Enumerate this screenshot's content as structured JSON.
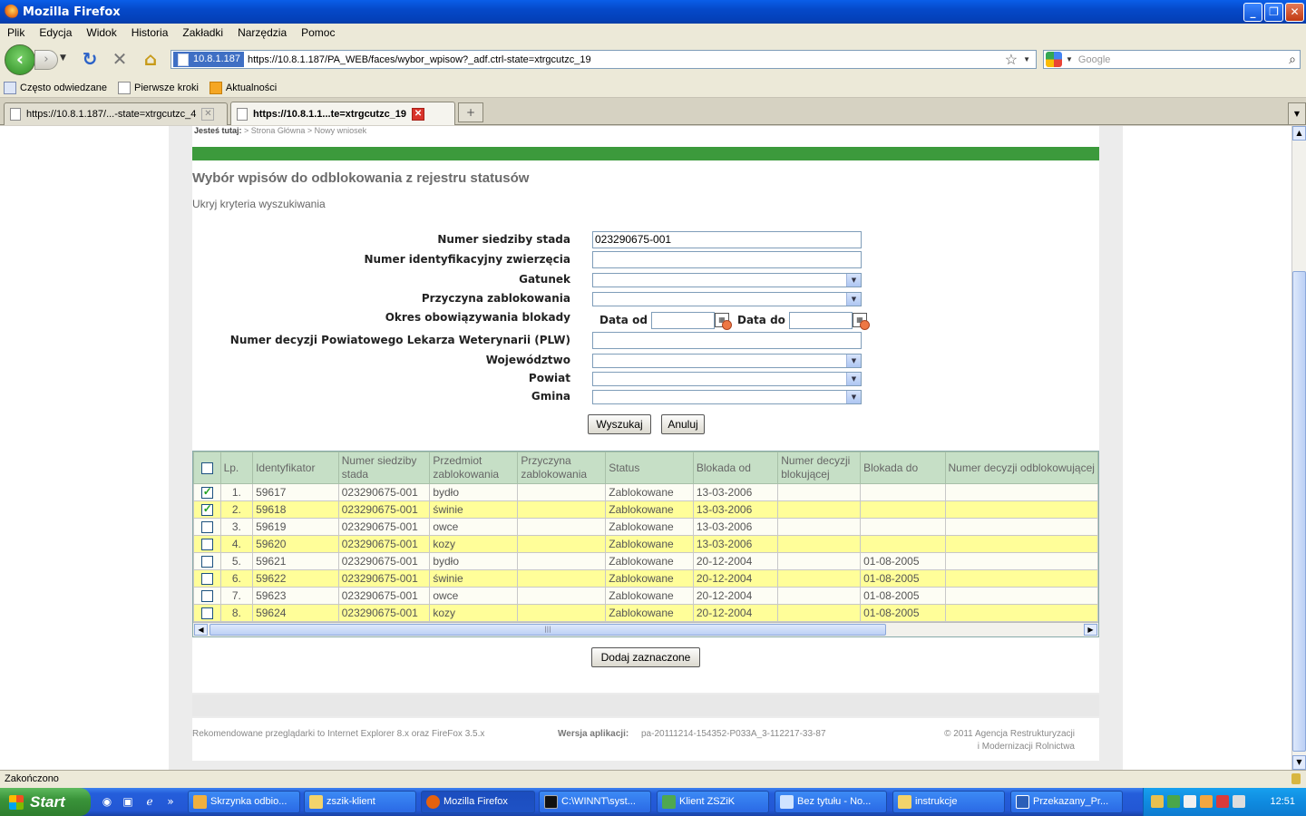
{
  "window": {
    "title": "Mozilla Firefox",
    "min": "_",
    "max": "❐",
    "close": "✕"
  },
  "menu": [
    "Plik",
    "Edycja",
    "Widok",
    "Historia",
    "Zakładki",
    "Narzędzia",
    "Pomoc"
  ],
  "nav": {
    "identity": "10.8.1.187",
    "url": "https://10.8.1.187/PA_WEB/faces/wybor_wpisow?_adf.ctrl-state=xtrgcutzc_19",
    "search_placeholder": "Google"
  },
  "bookmarks": [
    "Często odwiedzane",
    "Pierwsze kroki",
    "Aktualności"
  ],
  "tabs": [
    {
      "label": "https://10.8.1.187/...-state=xtrgcutzc_4"
    },
    {
      "label": "https://10.8.1.1...te=xtrgcutzc_19"
    }
  ],
  "page": {
    "breadcrumb_prefix": "Jesteś tutaj:",
    "breadcrumb": "> Strona Główna > Nowy wniosek",
    "title": "Wybór wpisów do odblokowania z rejestru statusów",
    "hide_criteria": "Ukryj kryteria wyszukiwania",
    "form": {
      "herd_label": "Numer siedziby stada",
      "herd_value": "023290675-001",
      "animal_label": "Numer identyfikacyjny zwierzęcia",
      "species_label": "Gatunek",
      "reason_label": "Przyczyna zablokowania",
      "period_label": "Okres obowiązywania blokady",
      "date_from_label": "Data od",
      "date_to_label": "Data do",
      "decision_label": "Numer decyzji Powiatowego Lekarza Weterynarii (PLW)",
      "voivodeship_label": "Województwo",
      "county_label": "Powiat",
      "commune_label": "Gmina"
    },
    "search_button": "Wyszukaj",
    "cancel_button": "Anuluj",
    "add_button": "Dodaj zaznaczone"
  },
  "table": {
    "headers": [
      "Lp.",
      "Identyfikator",
      "Numer siedziby stada",
      "Przedmiot zablokowania",
      "Przyczyna zablokowania",
      "Status",
      "Blokada od",
      "Numer decyzji blokującej",
      "Blokada do",
      "Numer decyzji odblokowującej"
    ],
    "rows": [
      {
        "checked": true,
        "lp": "1.",
        "id": "59617",
        "herd": "023290675-001",
        "subject": "bydło",
        "reason": "",
        "status": "Zablokowane",
        "from": "13-03-2006",
        "decision": "",
        "to": ""
      },
      {
        "checked": true,
        "lp": "2.",
        "id": "59618",
        "herd": "023290675-001",
        "subject": "świnie",
        "reason": "",
        "status": "Zablokowane",
        "from": "13-03-2006",
        "decision": "",
        "to": ""
      },
      {
        "checked": false,
        "lp": "3.",
        "id": "59619",
        "herd": "023290675-001",
        "subject": "owce",
        "reason": "",
        "status": "Zablokowane",
        "from": "13-03-2006",
        "decision": "",
        "to": ""
      },
      {
        "checked": false,
        "lp": "4.",
        "id": "59620",
        "herd": "023290675-001",
        "subject": "kozy",
        "reason": "",
        "status": "Zablokowane",
        "from": "13-03-2006",
        "decision": "",
        "to": ""
      },
      {
        "checked": false,
        "lp": "5.",
        "id": "59621",
        "herd": "023290675-001",
        "subject": "bydło",
        "reason": "",
        "status": "Zablokowane",
        "from": "20-12-2004",
        "decision": "",
        "to": "01-08-2005"
      },
      {
        "checked": false,
        "lp": "6.",
        "id": "59622",
        "herd": "023290675-001",
        "subject": "świnie",
        "reason": "",
        "status": "Zablokowane",
        "from": "20-12-2004",
        "decision": "",
        "to": "01-08-2005"
      },
      {
        "checked": false,
        "lp": "7.",
        "id": "59623",
        "herd": "023290675-001",
        "subject": "owce",
        "reason": "",
        "status": "Zablokowane",
        "from": "20-12-2004",
        "decision": "",
        "to": "01-08-2005"
      },
      {
        "checked": false,
        "lp": "8.",
        "id": "59624",
        "herd": "023290675-001",
        "subject": "kozy",
        "reason": "",
        "status": "Zablokowane",
        "from": "20-12-2004",
        "decision": "",
        "to": "01-08-2005"
      }
    ]
  },
  "footer": {
    "browsers": "Rekomendowane przeglądarki to Internet Explorer 8.x oraz FireFox 3.5.x",
    "version_label": "Wersja aplikacji:",
    "version": "pa-20111214-154352-P033A_3-112217-33-87",
    "copyright_1": "© 2011 Agencja Restrukturyzacji",
    "copyright_2": "i Modernizacji Rolnictwa"
  },
  "status": "Zakończono",
  "taskbar": {
    "start": "Start",
    "tasks": [
      "Skrzynka odbio...",
      "zszik-klient",
      "Mozilla Firefox",
      "C:\\WINNT\\syst...",
      "Klient ZSZiK",
      "Bez tytułu - No...",
      "instrukcje",
      "Przekazany_Pr..."
    ],
    "clock": "12:51"
  }
}
